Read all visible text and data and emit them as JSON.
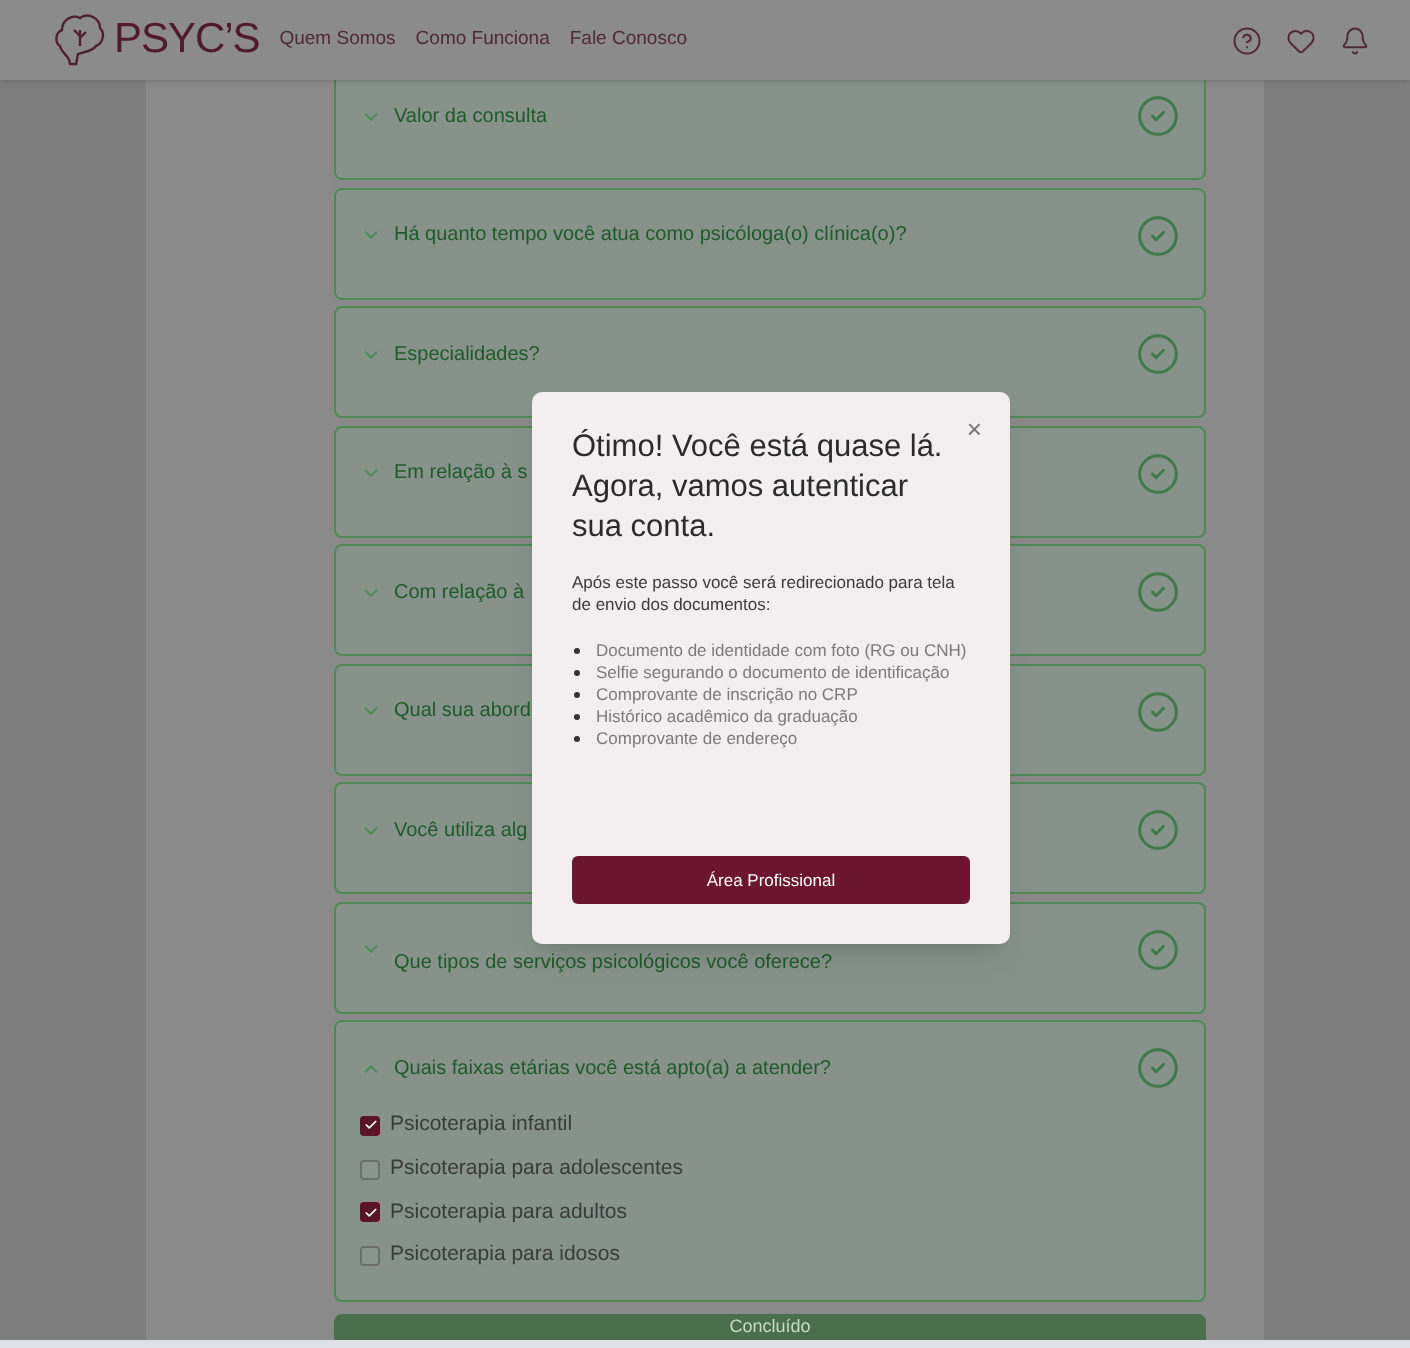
{
  "header": {
    "brand": "PSYC’S",
    "nav": [
      "Quem Somos",
      "Como Funciona",
      "Fale Conosco"
    ]
  },
  "questions": [
    {
      "title": "Valor da consulta",
      "expanded": false,
      "done": true
    },
    {
      "title": "Há quanto tempo você atua como psicóloga(o) clínica(o)?",
      "expanded": false,
      "done": true
    },
    {
      "title": "Especialidades?",
      "expanded": false,
      "done": true
    },
    {
      "title": "Em relação à s",
      "expanded": false,
      "done": true
    },
    {
      "title": "Com relação à",
      "expanded": false,
      "done": true
    },
    {
      "title": "Qual sua abord",
      "expanded": false,
      "done": true
    },
    {
      "title": "Você utiliza alg",
      "expanded": false,
      "done": true
    },
    {
      "title": "Que tipos de serviços psicológicos você oferece?",
      "expanded": false,
      "done": true
    },
    {
      "title": "Quais faixas etárias você está apto(a) a atender?",
      "expanded": true,
      "done": true,
      "options": [
        {
          "label": "Psicoterapia infantil",
          "checked": true
        },
        {
          "label": "Psicoterapia para adolescentes",
          "checked": false
        },
        {
          "label": "Psicoterapia para adultos",
          "checked": true
        },
        {
          "label": "Psicoterapia para idosos",
          "checked": false
        }
      ]
    }
  ],
  "submit": "Concluído",
  "modal": {
    "title": "Ótimo! Você está quase lá. Agora, vamos autenticar sua conta.",
    "close": "×",
    "intro": "Após este passo você será redirecionado para tela de envio dos documentos:",
    "items": [
      "Documento de identidade com foto (RG ou CNH)",
      "Selfie segurando o documento de identificação",
      "Comprovante de inscrição no CRP",
      "Histórico acadêmico da graduação",
      "Comprovante de endereço"
    ],
    "button": "Área Profissional"
  }
}
